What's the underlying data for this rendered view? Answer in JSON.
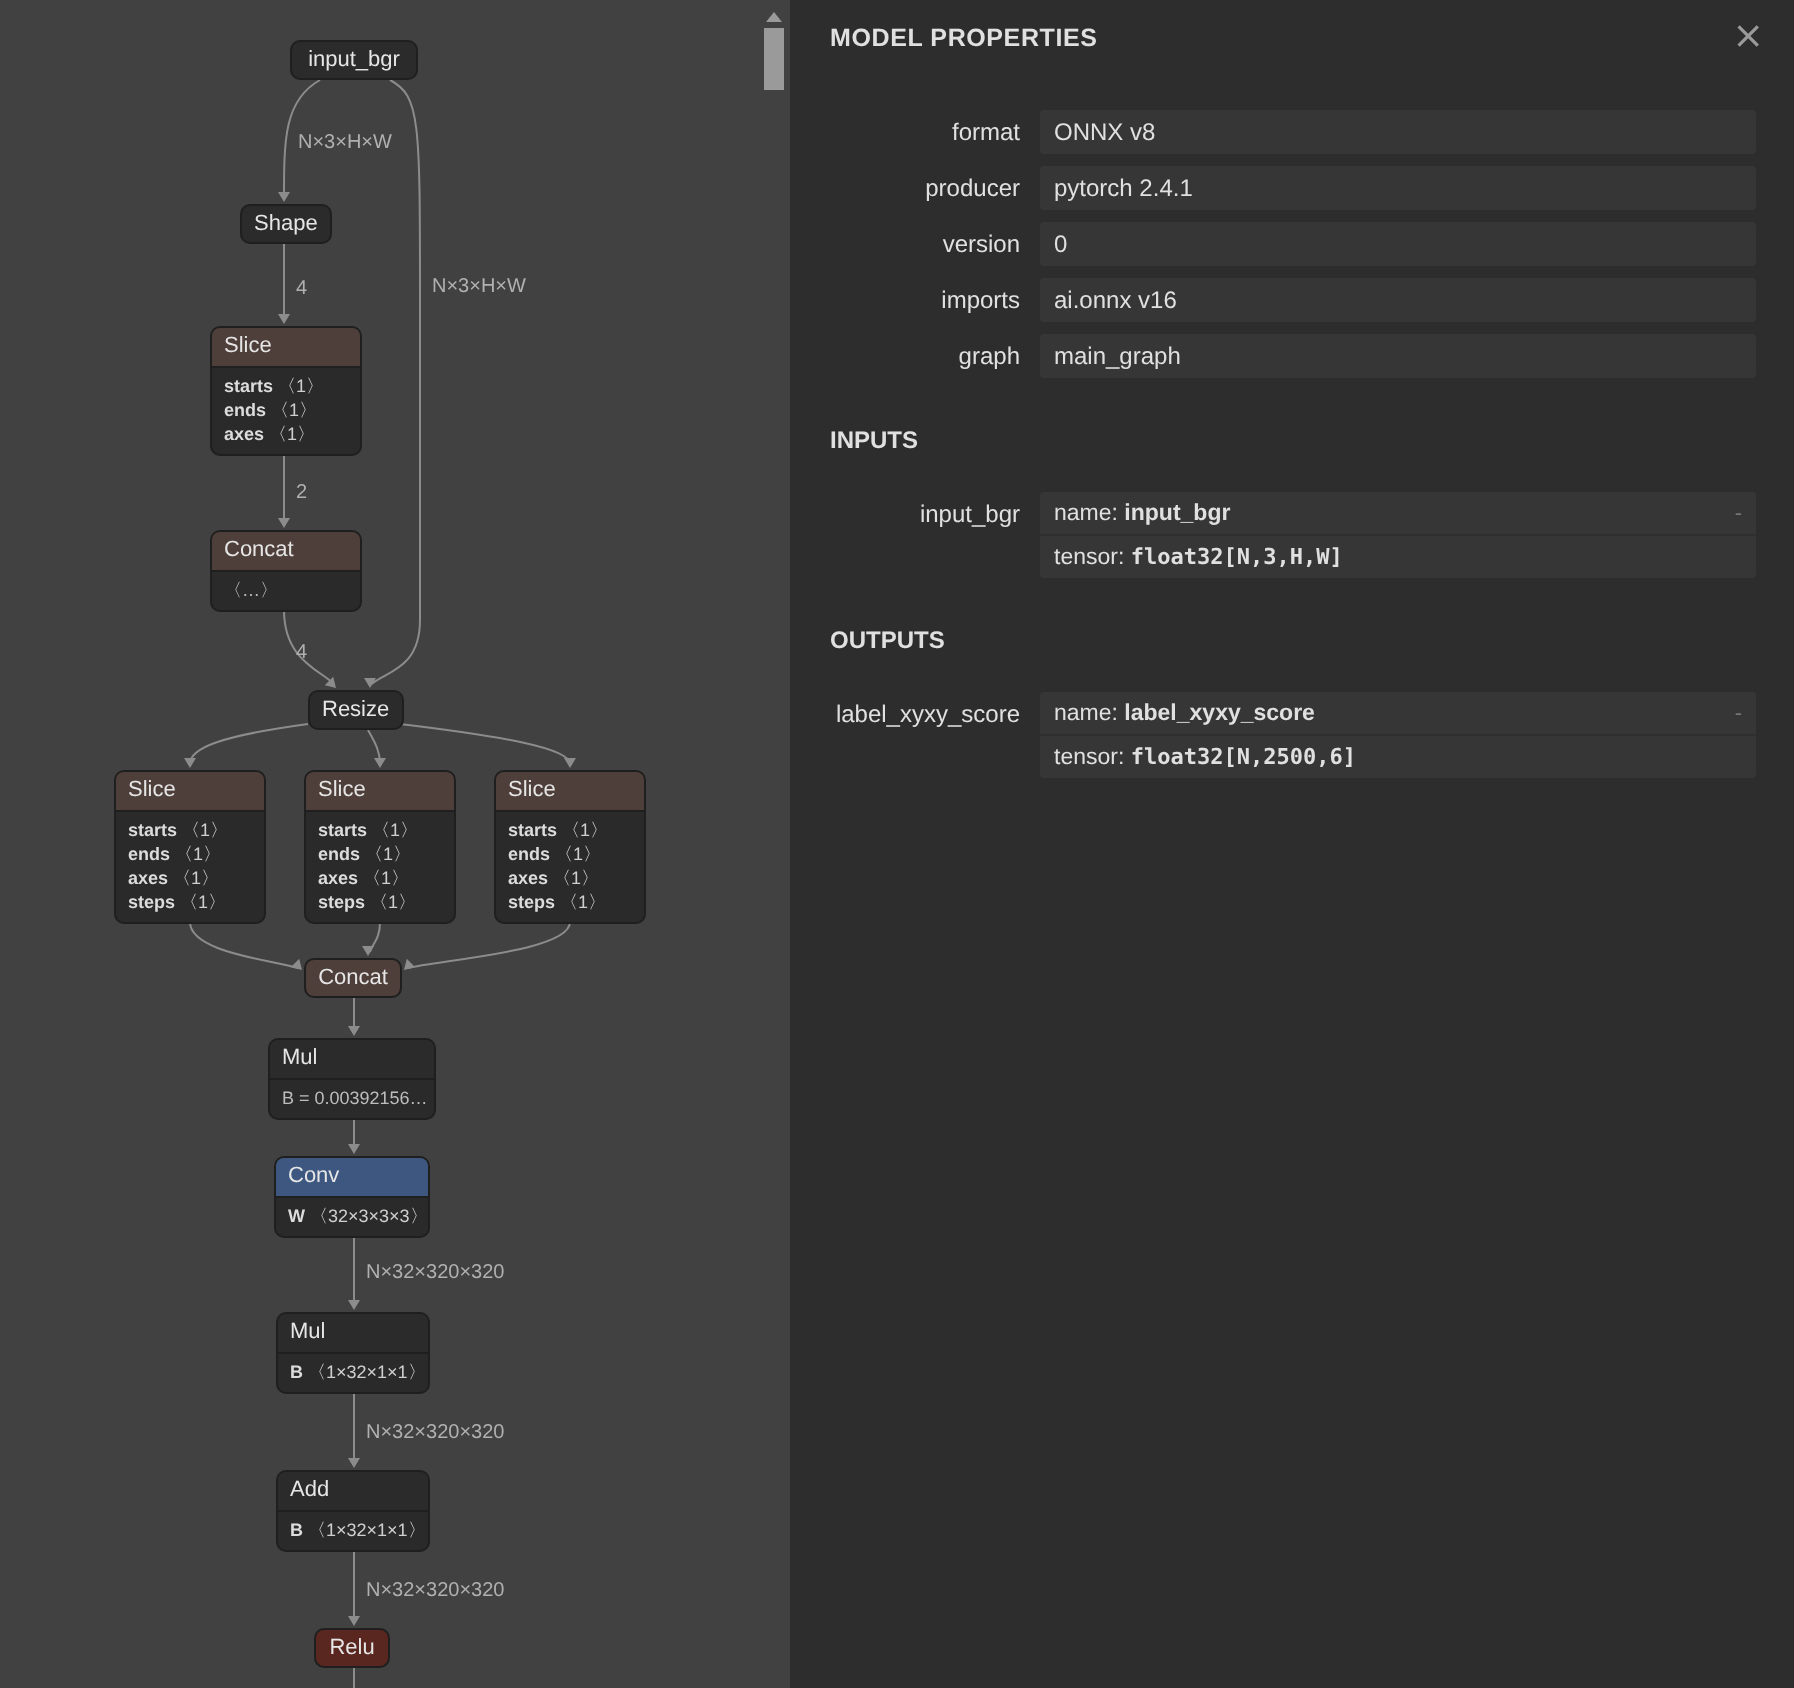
{
  "graph": {
    "nodes": [
      {
        "title": "input_bgr",
        "kind": "plain"
      },
      {
        "title": "Shape",
        "kind": "plain"
      },
      {
        "title": "Slice",
        "kind": "layer",
        "attributes": [
          {
            "name": "starts",
            "value": "〈1〉"
          },
          {
            "name": "ends",
            "value": "〈1〉"
          },
          {
            "name": "axes",
            "value": "〈1〉"
          }
        ]
      },
      {
        "title": "Concat",
        "kind": "layer",
        "attributes": [
          {
            "text": "〈…〉"
          }
        ]
      },
      {
        "title": "Resize",
        "kind": "plain"
      },
      {
        "title": "Slice",
        "kind": "layer",
        "attributes": [
          {
            "name": "starts",
            "value": "〈1〉"
          },
          {
            "name": "ends",
            "value": "〈1〉"
          },
          {
            "name": "axes",
            "value": "〈1〉"
          },
          {
            "name": "steps",
            "value": "〈1〉"
          }
        ]
      },
      {
        "title": "Slice",
        "kind": "layer",
        "attributes": [
          {
            "name": "starts",
            "value": "〈1〉"
          },
          {
            "name": "ends",
            "value": "〈1〉"
          },
          {
            "name": "axes",
            "value": "〈1〉"
          },
          {
            "name": "steps",
            "value": "〈1〉"
          }
        ]
      },
      {
        "title": "Slice",
        "kind": "layer",
        "attributes": [
          {
            "name": "starts",
            "value": "〈1〉"
          },
          {
            "name": "ends",
            "value": "〈1〉"
          },
          {
            "name": "axes",
            "value": "〈1〉"
          },
          {
            "name": "steps",
            "value": "〈1〉"
          }
        ]
      },
      {
        "title": "Concat",
        "kind": "layer"
      },
      {
        "title": "Mul",
        "kind": "plain",
        "attributes": [
          {
            "text": "B = 0.00392156…"
          }
        ]
      },
      {
        "title": "Conv",
        "kind": "conv",
        "attributes": [
          {
            "name": "W",
            "value": "〈32×3×3×3〉"
          }
        ]
      },
      {
        "title": "Mul",
        "kind": "plain",
        "attributes": [
          {
            "name": "B",
            "value": "〈1×32×1×1〉"
          }
        ]
      },
      {
        "title": "Add",
        "kind": "plain",
        "attributes": [
          {
            "name": "B",
            "value": "〈1×32×1×1〉"
          }
        ]
      },
      {
        "title": "Relu",
        "kind": "activation"
      }
    ],
    "edge_labels": [
      "N×3×H×W",
      "N×3×H×W",
      "4",
      "2",
      "4",
      "N×32×320×320",
      "N×32×320×320",
      "N×32×320×320"
    ]
  },
  "properties": {
    "title": "MODEL PROPERTIES",
    "close": "×",
    "model": [
      {
        "label": "format",
        "value": "ONNX v8"
      },
      {
        "label": "producer",
        "value": "pytorch 2.4.1"
      },
      {
        "label": "version",
        "value": "0"
      },
      {
        "label": "imports",
        "value": "ai.onnx v16"
      },
      {
        "label": "graph",
        "value": "main_graph"
      }
    ],
    "sections": [
      {
        "title": "INPUTS",
        "items": [
          {
            "label": "input_bgr",
            "name_label": "name:",
            "name": "input_bgr",
            "type_label": "tensor:",
            "type": "float32[N,3,H,W]",
            "toggle": "-"
          }
        ]
      },
      {
        "title": "OUTPUTS",
        "items": [
          {
            "label": "label_xyxy_score",
            "name_label": "name:",
            "name": "label_xyxy_score",
            "type_label": "tensor:",
            "type": "float32[N,2500,6]",
            "toggle": "-"
          }
        ]
      }
    ]
  }
}
